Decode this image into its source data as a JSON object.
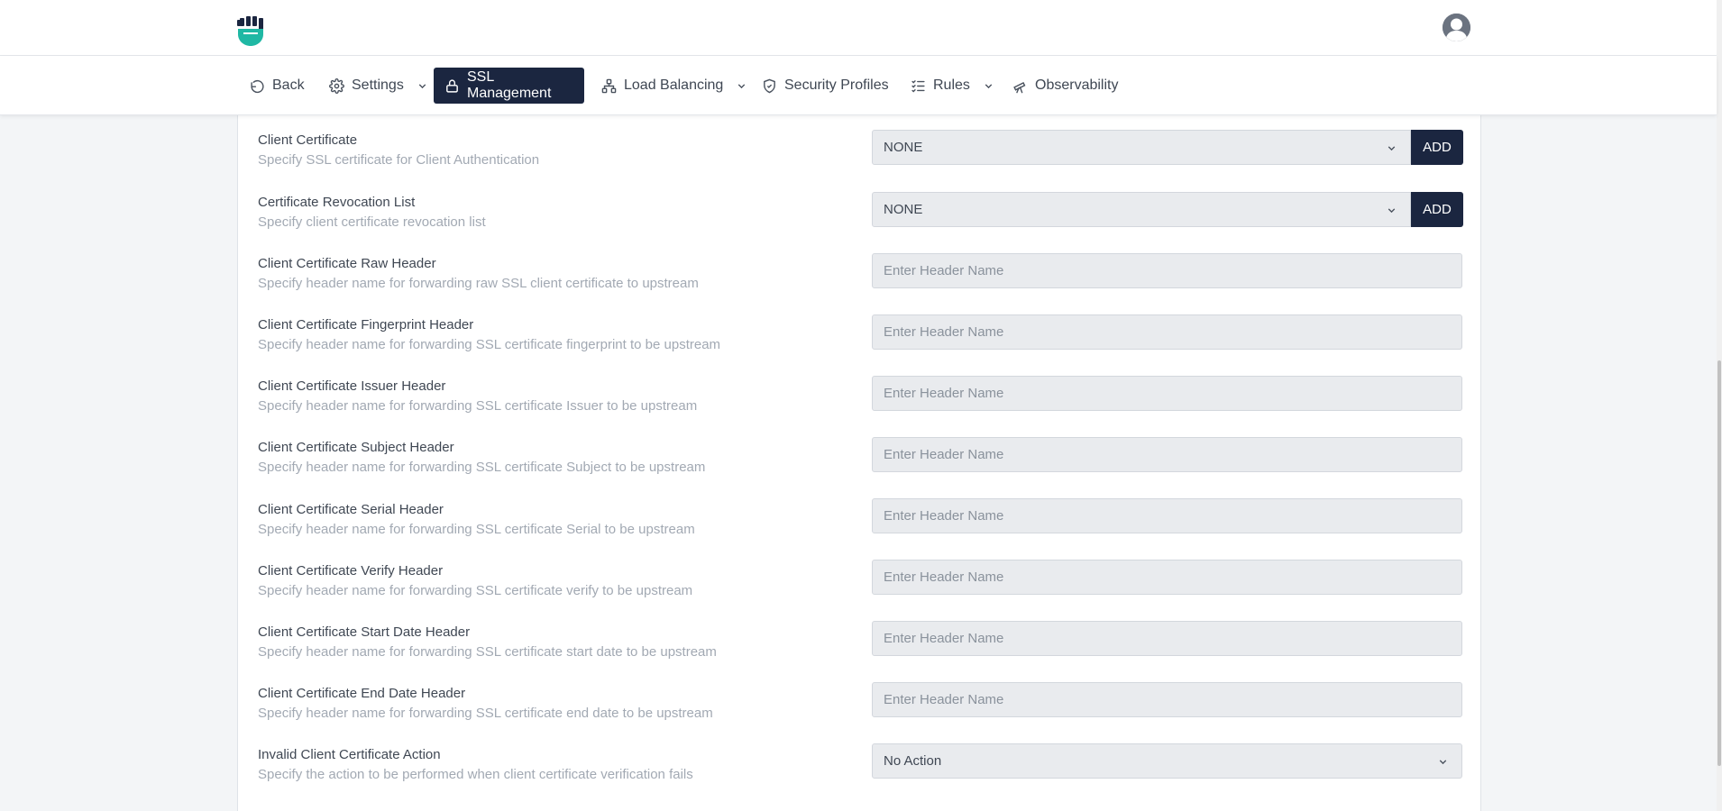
{
  "nav": {
    "items": [
      {
        "label": "Back",
        "icon": "undo-icon"
      },
      {
        "label": "Settings",
        "icon": "gear-icon"
      },
      {
        "label": "SSL Management",
        "icon": "lock-icon"
      },
      {
        "label": "Load Balancing",
        "icon": "network-icon"
      },
      {
        "label": "Security Profiles",
        "icon": "shield-icon"
      },
      {
        "label": "Rules",
        "icon": "list-check-icon"
      },
      {
        "label": "Observability",
        "icon": "telescope-icon"
      }
    ],
    "active": "SSL Management"
  },
  "form": {
    "client_certificate": {
      "label": "Client Certificate",
      "description": "Specify SSL certificate for Client Authentication",
      "value": "NONE",
      "button": "ADD"
    },
    "crl": {
      "label": "Certificate Revocation List",
      "description": "Specify client certificate revocation list",
      "value": "NONE",
      "button": "ADD"
    },
    "raw_header": {
      "label": "Client Certificate Raw Header",
      "description": "Specify header name for forwarding raw SSL client certificate to upstream",
      "placeholder": "Enter Header Name"
    },
    "fingerprint_header": {
      "label": "Client Certificate Fingerprint Header",
      "description": "Specify header name for forwarding SSL certificate fingerprint to be upstream",
      "placeholder": "Enter Header Name"
    },
    "issuer_header": {
      "label": "Client Certificate Issuer Header",
      "description": "Specify header name for forwarding SSL certificate Issuer to be upstream",
      "placeholder": "Enter Header Name"
    },
    "subject_header": {
      "label": "Client Certificate Subject Header",
      "description": "Specify header name for forwarding SSL certificate Subject to be upstream",
      "placeholder": "Enter Header Name"
    },
    "serial_header": {
      "label": "Client Certificate Serial Header",
      "description": "Specify header name for forwarding SSL certificate Serial to be upstream",
      "placeholder": "Enter Header Name"
    },
    "verify_header": {
      "label": "Client Certificate Verify Header",
      "description": "Specify header name for forwarding SSL certificate verify to be upstream",
      "placeholder": "Enter Header Name"
    },
    "start_date_header": {
      "label": "Client Certificate Start Date Header",
      "description": "Specify header name for forwarding SSL certificate start date to be upstream",
      "placeholder": "Enter Header Name"
    },
    "end_date_header": {
      "label": "Client Certificate End Date Header",
      "description": "Specify header name for forwarding SSL certificate end date to be upstream",
      "placeholder": "Enter Header Name"
    },
    "invalid_action": {
      "label": "Invalid Client Certificate Action",
      "description": "Specify the action to be performed when client certificate verification fails",
      "value": "No Action"
    }
  },
  "colors": {
    "brand": "#1fb8a4",
    "primary_dark": "#1b2640",
    "field_bg": "#e9ebee",
    "muted_text": "#a2a9b3"
  }
}
